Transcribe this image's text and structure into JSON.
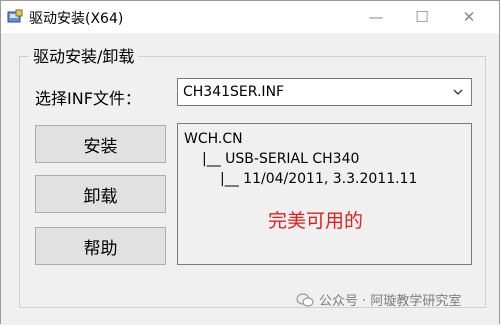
{
  "window": {
    "title": "驱动安装(X64)",
    "buttons": {
      "minimize": "—",
      "maximize": "☐",
      "close": "✕"
    }
  },
  "group": {
    "label": "驱动安装/卸载"
  },
  "select": {
    "label": "选择INF文件：",
    "value": "CH341SER.INF"
  },
  "buttons": {
    "install": "安装",
    "uninstall": "卸载",
    "help": "帮助"
  },
  "info": {
    "line1": "WCH.CN",
    "line2": "|__ USB-SERIAL CH340",
    "line3": "|__ 11/04/2011, 3.3.2011.11"
  },
  "annotation": "完美可用的",
  "watermark": "公众号 · 阿璇教学研究室",
  "colors": {
    "annotation": "#e02020",
    "window_bg": "#f0f0f0"
  },
  "icons": {
    "app": "installer-icon",
    "dropdown": "chevron-down-icon",
    "watermark": "wechat-icon"
  }
}
